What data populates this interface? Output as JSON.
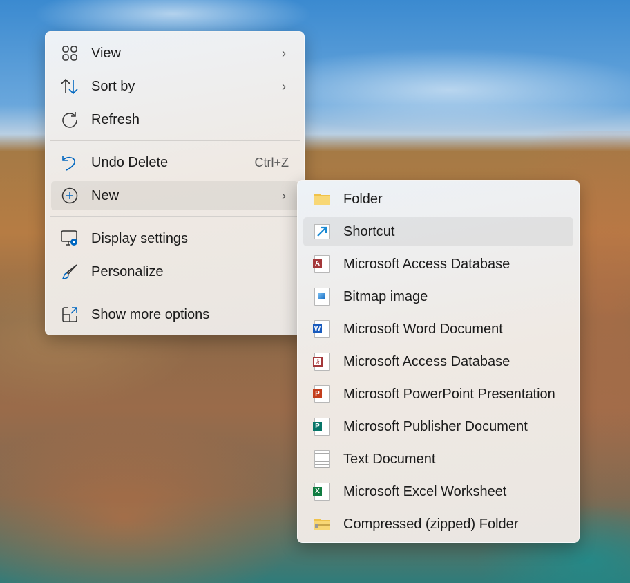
{
  "main_menu": {
    "items": [
      {
        "label": "View",
        "icon": "grid-icon",
        "submenu": true
      },
      {
        "label": "Sort by",
        "icon": "sort-icon",
        "submenu": true
      },
      {
        "label": "Refresh",
        "icon": "refresh-icon"
      },
      {
        "label": "Undo Delete",
        "icon": "undo-icon",
        "shortcut": "Ctrl+Z"
      },
      {
        "label": "New",
        "icon": "plus-circle-icon",
        "submenu": true
      },
      {
        "label": "Display settings",
        "icon": "display-settings-icon"
      },
      {
        "label": "Personalize",
        "icon": "brush-icon"
      },
      {
        "label": "Show more options",
        "icon": "expand-icon"
      }
    ]
  },
  "new_submenu": {
    "items": [
      {
        "label": "Folder"
      },
      {
        "label": "Shortcut"
      },
      {
        "label": "Microsoft Access Database"
      },
      {
        "label": "Bitmap image"
      },
      {
        "label": "Microsoft Word Document"
      },
      {
        "label": "Microsoft Access Database"
      },
      {
        "label": "Microsoft PowerPoint Presentation"
      },
      {
        "label": "Microsoft Publisher Document"
      },
      {
        "label": "Text Document"
      },
      {
        "label": "Microsoft Excel Worksheet"
      },
      {
        "label": "Compressed (zipped) Folder"
      }
    ]
  },
  "colors": {
    "accent": "#0067c0",
    "access": "#a4373a",
    "word": "#185abd",
    "powerpoint": "#c43e1c",
    "publisher": "#077568",
    "excel": "#107c41",
    "folder": "#f8d775"
  }
}
